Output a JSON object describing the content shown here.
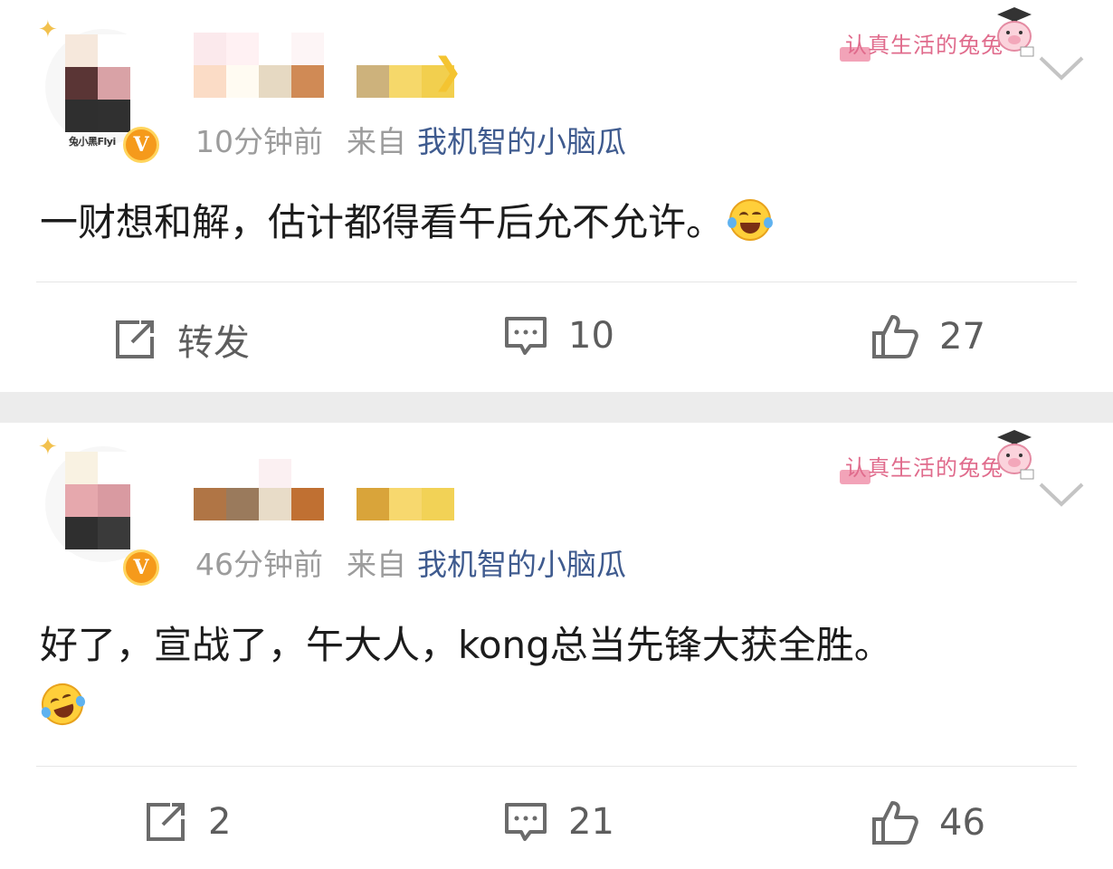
{
  "sticker_text": "认真生活的兔兔",
  "colors": {
    "accent_link": "#3f5b8f",
    "meta_gray": "#9c9c9c",
    "vip_badge": "#f59a1b",
    "separator": "#ececec"
  },
  "posts": [
    {
      "avatar_caption": "兔小黑Flyi",
      "time": "10分钟前",
      "source_prefix": "来自",
      "source_app": "我机智的小脑瓜",
      "content": "一财想和解，估计都得看午后允不允许。",
      "emoji": "laughing-tears-emoji",
      "actions": {
        "repost_label": "转发",
        "comment_count": "10",
        "like_count": "27"
      }
    },
    {
      "time": "46分钟前",
      "source_prefix": "来自",
      "source_app": "我机智的小脑瓜",
      "content": "好了，宣战了，午大人，kong总当先锋大获全胜。",
      "emoji": "crying-laughing-emoji",
      "actions": {
        "repost_count": "2",
        "comment_count": "21",
        "like_count": "46"
      }
    }
  ]
}
